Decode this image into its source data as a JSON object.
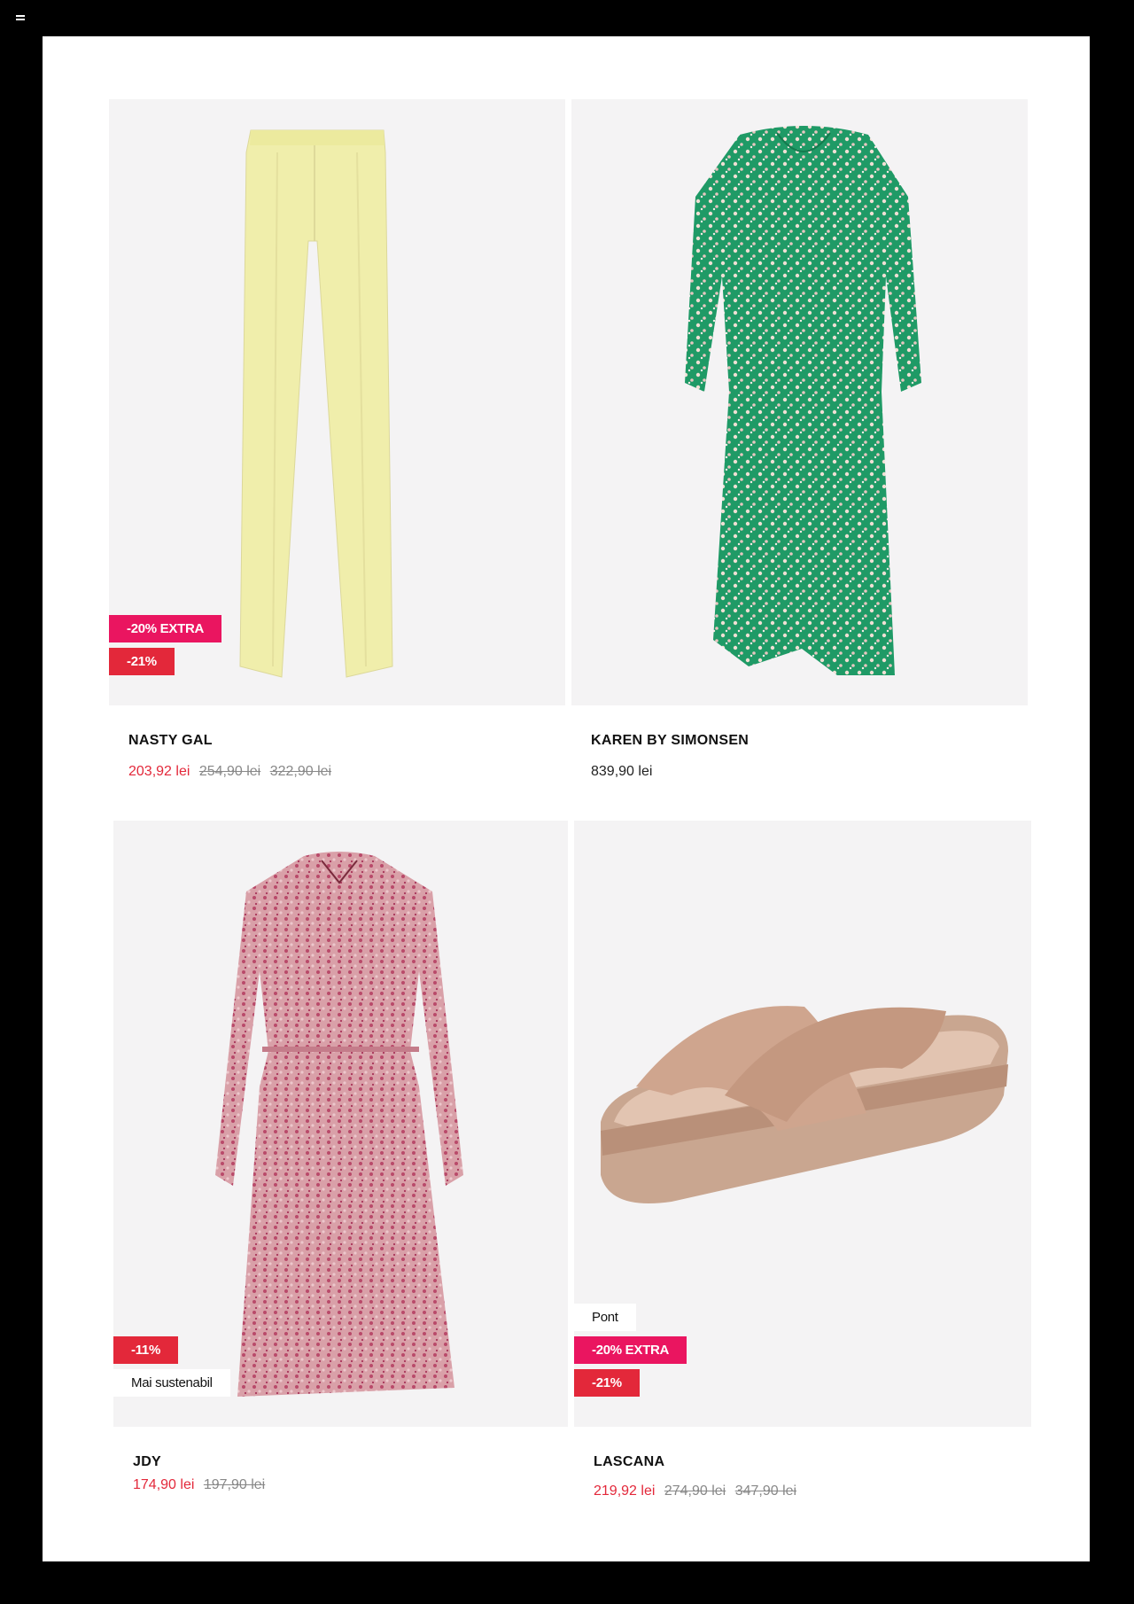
{
  "toolbar": {
    "menu_icon": "hamburger-menu-icon"
  },
  "colors": {
    "sale": "#e3283a",
    "extra_badge": "#ea1560",
    "card_bg": "#f4f3f4"
  },
  "products": [
    {
      "brand": "NASTY GAL",
      "image": "yellow-wide-leg-trousers",
      "badges": [
        "-20% EXTRA",
        "-21%"
      ],
      "price_sale": "203,92 lei",
      "price_old_1": "254,90 lei",
      "price_old_2": "322,90 lei"
    },
    {
      "brand": "KAREN BY SIMONSEN",
      "image": "green-floral-maxi-dress",
      "price": "839,90 lei"
    },
    {
      "brand": "JDY",
      "image": "pink-floral-dress",
      "badges": [
        "-11%",
        "Mai sustenabil"
      ],
      "price_sale": "174,90 lei",
      "price_old_1": "197,90 lei"
    },
    {
      "brand": "LASCANA",
      "image": "beige-wedge-sandal",
      "badges": [
        "Pont",
        "-20% EXTRA",
        "-21%"
      ],
      "price_sale": "219,92 lei",
      "price_old_1": "274,90 lei",
      "price_old_2": "347,90 lei"
    }
  ]
}
